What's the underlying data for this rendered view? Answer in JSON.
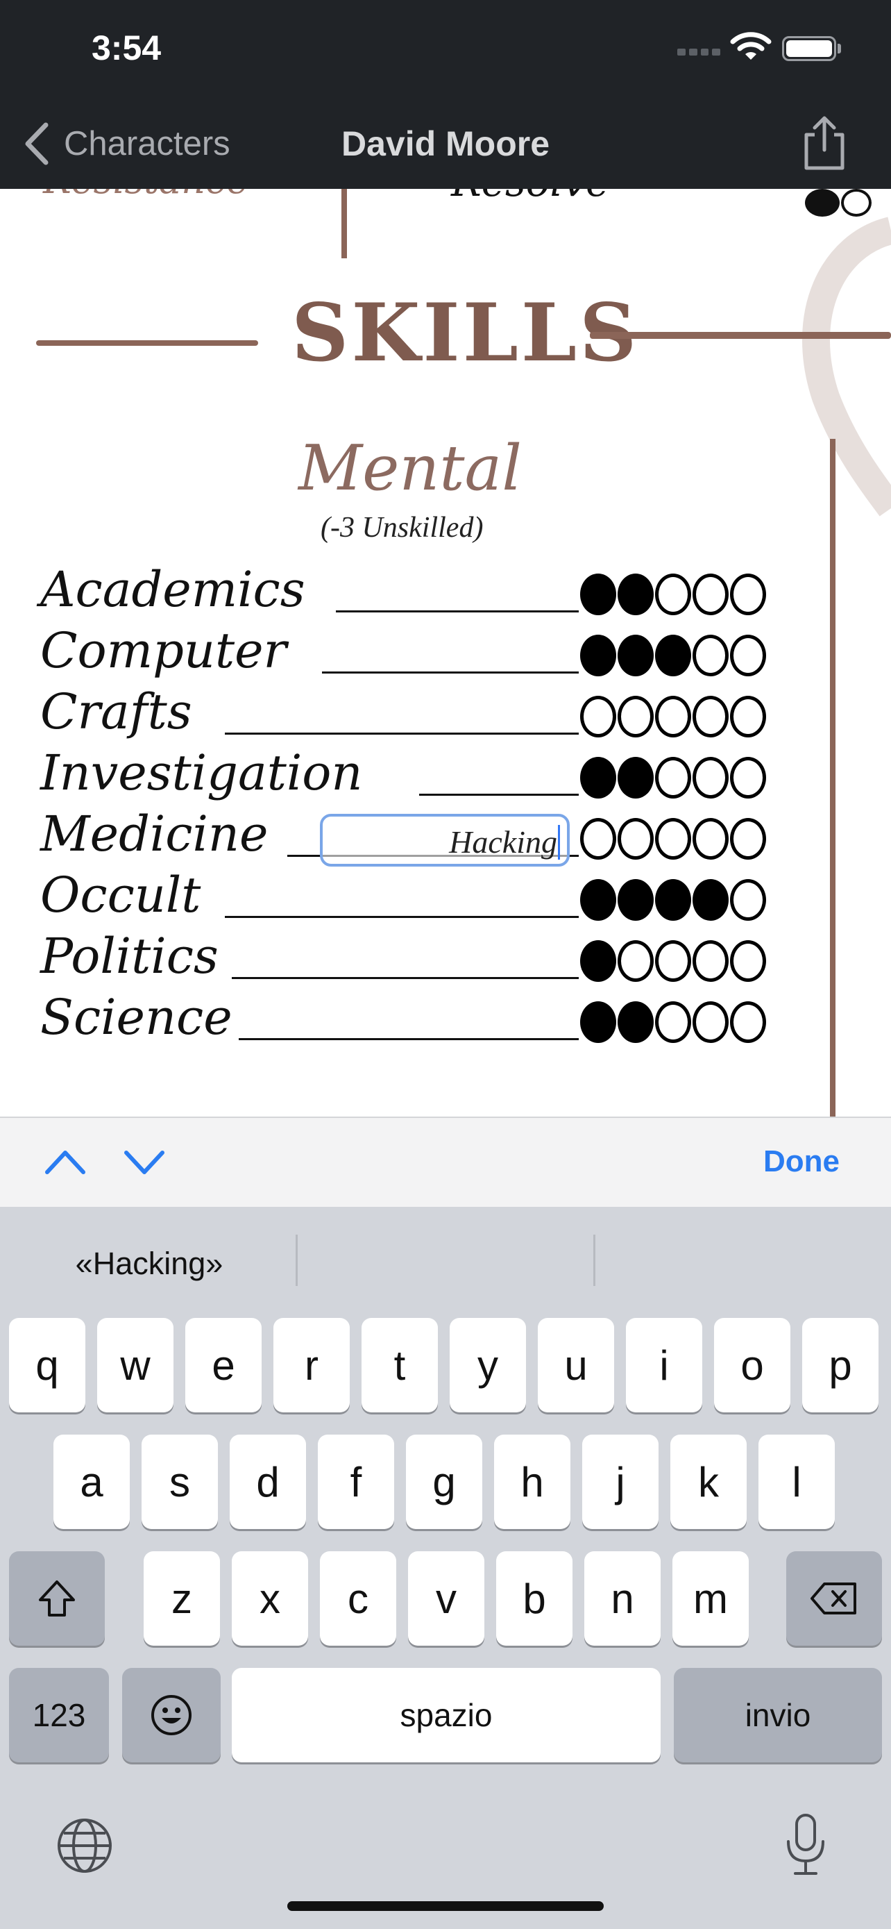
{
  "status_bar": {
    "time": "3:54"
  },
  "nav": {
    "back_label": "Characters",
    "title": "David Moore"
  },
  "sheet": {
    "partial_left": "Resistance",
    "partial_right": "Resolve",
    "section_title": "SKILLS",
    "category": "Mental",
    "category_note": "(-3 Unskilled)",
    "specialty_value": "Hacking",
    "skills": [
      {
        "name": "Academics",
        "rating": 2
      },
      {
        "name": "Computer",
        "rating": 3
      },
      {
        "name": "Crafts",
        "rating": 0
      },
      {
        "name": "Investigation",
        "rating": 2
      },
      {
        "name": "Medicine",
        "rating": 0
      },
      {
        "name": "Occult",
        "rating": 4
      },
      {
        "name": "Politics",
        "rating": 1
      },
      {
        "name": "Science",
        "rating": 2
      }
    ],
    "max_rating": 5
  },
  "accessory": {
    "done_label": "Done"
  },
  "keyboard": {
    "suggestions": [
      "«Hacking»",
      "",
      ""
    ],
    "row1": [
      "q",
      "w",
      "e",
      "r",
      "t",
      "y",
      "u",
      "i",
      "o",
      "p"
    ],
    "row2": [
      "a",
      "s",
      "d",
      "f",
      "g",
      "h",
      "j",
      "k",
      "l"
    ],
    "row3": [
      "z",
      "x",
      "c",
      "v",
      "b",
      "n",
      "m"
    ],
    "numbers_label": "123",
    "space_label": "spazio",
    "return_label": "invio"
  }
}
